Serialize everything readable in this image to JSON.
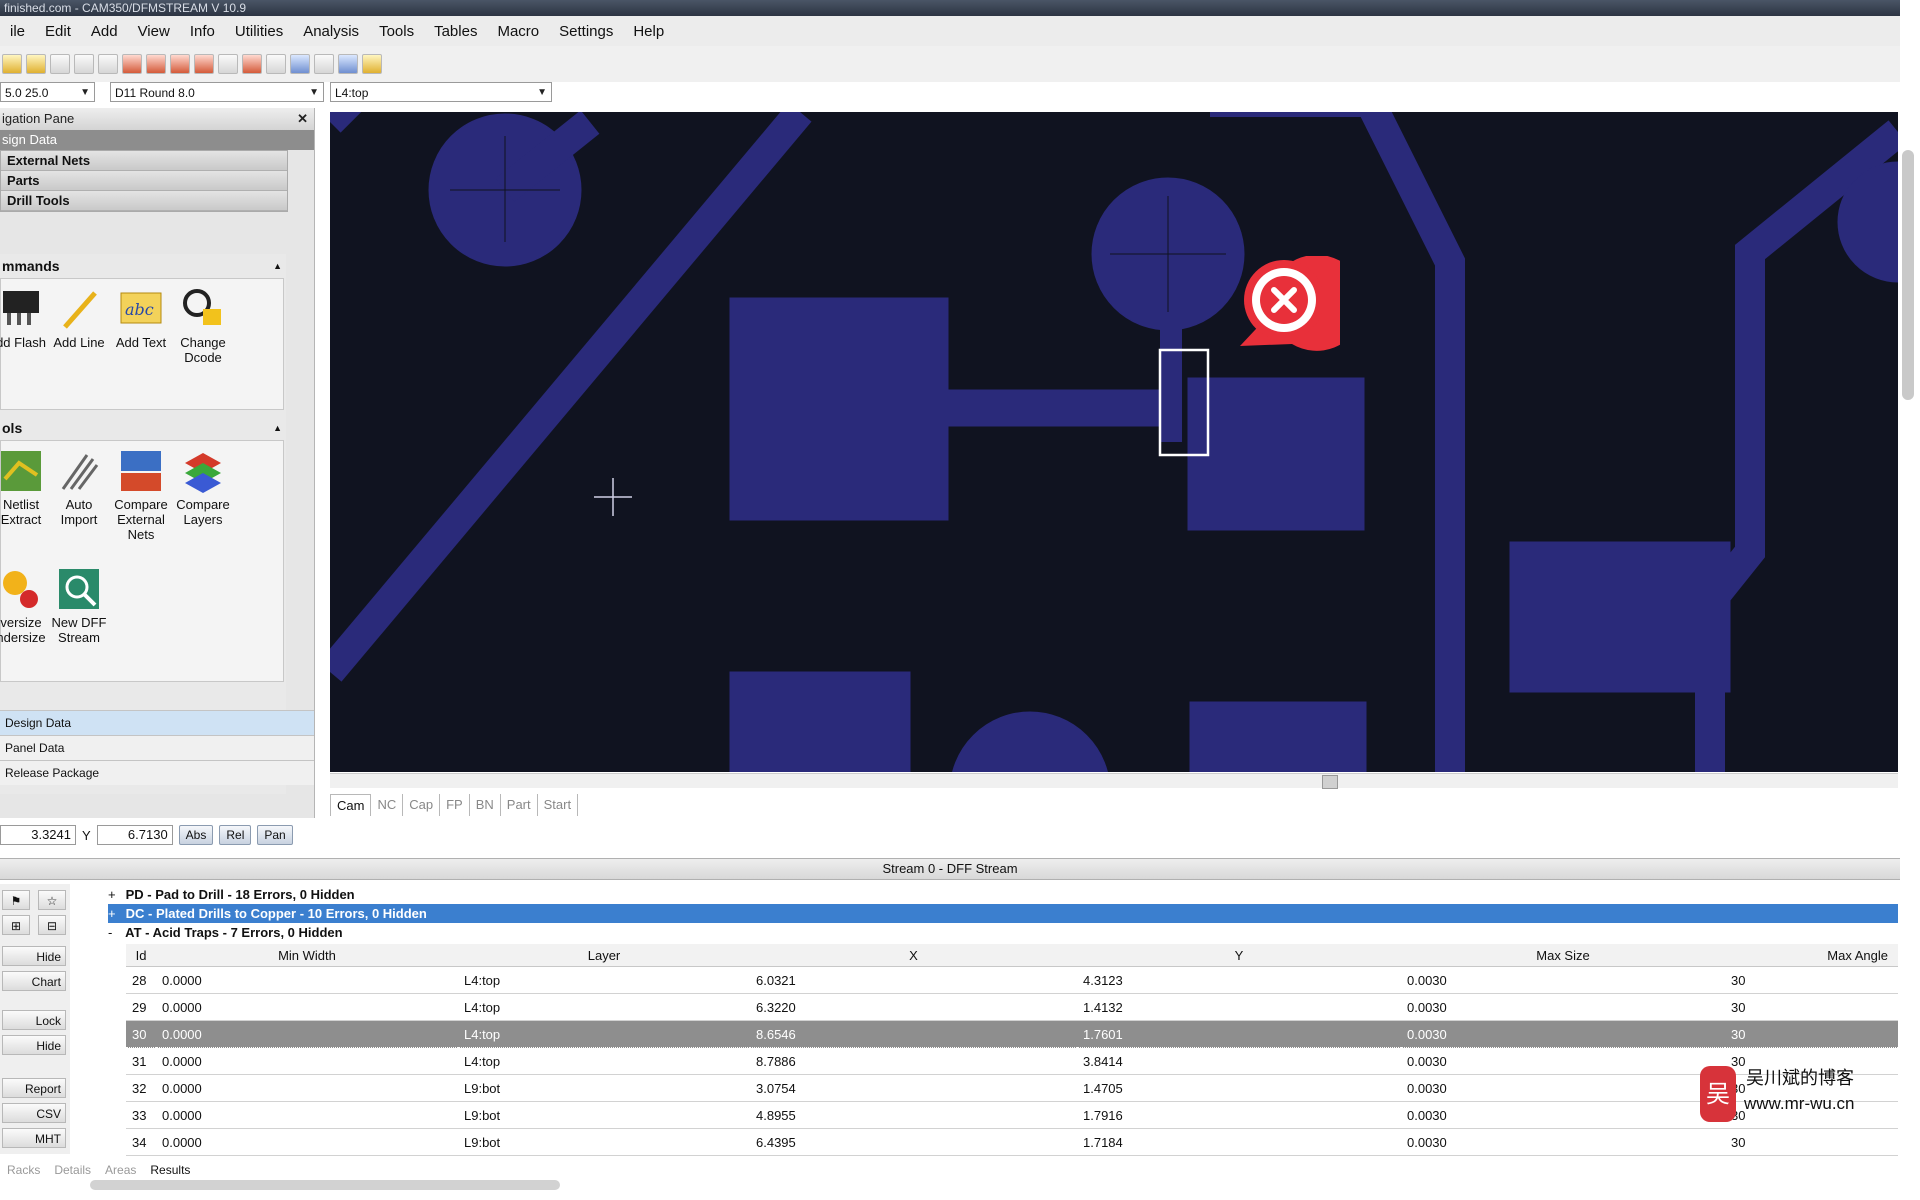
{
  "window": {
    "title": "finished.com - CAM350/DFMSTREAM V 10.9"
  },
  "menu": [
    "ile",
    "Edit",
    "Add",
    "View",
    "Info",
    "Utilities",
    "Analysis",
    "Tools",
    "Tables",
    "Macro",
    "Settings",
    "Help"
  ],
  "toolbar": {
    "icons": [
      "open-icon",
      "folder-icon",
      "save-icon",
      "undo-icon",
      "redo-icon",
      "zoom-window-icon",
      "zoom-in-icon",
      "zoom-out-icon",
      "zoom-all-icon",
      "redraw-icon",
      "print-icon",
      "layer-icon",
      "grid-icon",
      "snap-icon",
      "color-icon",
      "palette-icon"
    ],
    "combo_zoom": "5.0 25.0",
    "combo_dcode": "D11   Round 8.0",
    "combo_layer": "L4:top"
  },
  "nav": {
    "title": "igation Pane",
    "section": "sign Data",
    "tree": [
      "External Nets",
      "Parts",
      "Drill Tools"
    ],
    "commands_title": "mmands",
    "commands": [
      {
        "icon": "add-flash-icon",
        "label": "dd Flash"
      },
      {
        "icon": "add-line-icon",
        "label": "Add Line"
      },
      {
        "icon": "add-text-icon",
        "label": "Add Text"
      },
      {
        "icon": "change-dcode-icon",
        "label": "Change Dcode"
      }
    ],
    "tools_title": "ols",
    "tools": [
      {
        "icon": "netlist-extract-icon",
        "label": "Netlist Extract"
      },
      {
        "icon": "auto-import-icon",
        "label": "Auto Import"
      },
      {
        "icon": "compare-nets-icon",
        "label": "Compare External Nets"
      },
      {
        "icon": "compare-layers-icon",
        "label": "Compare Layers"
      },
      {
        "icon": "oversize-icon",
        "label": "versize ndersize"
      },
      {
        "icon": "new-dff-stream-icon",
        "label": "New DFF Stream"
      }
    ],
    "bottom": [
      "Design Data",
      "Panel Data",
      "Release Package"
    ]
  },
  "canvas": {
    "colors": {
      "background": "#101320",
      "copper": "#2a2a7a",
      "marker": "#e8303a",
      "highlight": "#ffffff"
    },
    "error_icon": "error-marker-icon",
    "cursor": "crosshair-icon"
  },
  "cam_tabs": [
    "Cam",
    "NC",
    "Cap",
    "FP",
    "BN",
    "Part",
    "Start"
  ],
  "coords": {
    "x_label": "",
    "x": "3.3241",
    "y_label": "Y",
    "y": "6.7130",
    "buttons": [
      "Abs",
      "Rel",
      "Pan"
    ]
  },
  "results": {
    "stream_title": "Stream 0 - DFF Stream",
    "groups": [
      {
        "toggle": "+",
        "label": "PD - Pad to Drill - 18 Errors, 0 Hidden"
      },
      {
        "toggle": "+",
        "label": "DC - Plated Drills to Copper - 10 Errors, 0 Hidden"
      },
      {
        "toggle": "-",
        "label": "AT - Acid Traps - 7 Errors, 0 Hidden"
      }
    ],
    "columns": [
      "Id",
      "Min Width",
      "Layer",
      "X",
      "Y",
      "Max Size",
      "Max Angle"
    ],
    "rows": [
      [
        "28",
        "0.0000",
        "L4:top",
        "6.0321",
        "4.3123",
        "0.0030",
        "30"
      ],
      [
        "29",
        "0.0000",
        "L4:top",
        "6.3220",
        "1.4132",
        "0.0030",
        "30"
      ],
      [
        "30",
        "0.0000",
        "L4:top",
        "8.6546",
        "1.7601",
        "0.0030",
        "30"
      ],
      [
        "31",
        "0.0000",
        "L4:top",
        "8.7886",
        "3.8414",
        "0.0030",
        "30"
      ],
      [
        "32",
        "0.0000",
        "L9:bot",
        "3.0754",
        "1.4705",
        "0.0030",
        "30"
      ],
      [
        "33",
        "0.0000",
        "L9:bot",
        "4.8955",
        "1.7916",
        "0.0030",
        "30"
      ],
      [
        "34",
        "0.0000",
        "L9:bot",
        "6.4395",
        "1.7184",
        "0.0030",
        "30"
      ]
    ],
    "selected_row": 2,
    "side_buttons": [
      "Hide",
      "Chart",
      "Lock",
      "Hide",
      "Report",
      "CSV",
      "MHT"
    ],
    "bottom_tabs": [
      "Racks",
      "Details",
      "Areas",
      "Results"
    ]
  },
  "watermark": {
    "logo": "吴",
    "name": "吴川斌的博客",
    "url": "www.mr-wu.cn"
  }
}
